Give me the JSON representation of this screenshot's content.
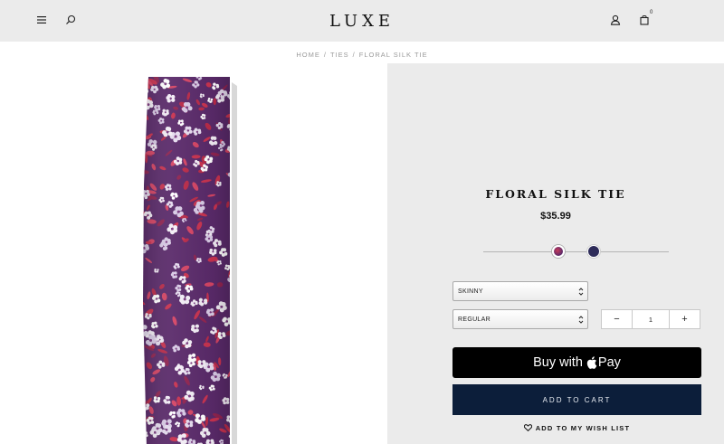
{
  "header": {
    "logo": "LUXE",
    "menu_icon": "menu-icon",
    "search_icon": "search-icon",
    "account_icon": "user-icon",
    "cart_icon": "shopping-bag-icon",
    "cart_count": "0"
  },
  "breadcrumb": {
    "items": [
      "HOME",
      "TIES",
      "FLORAL SILK TIE"
    ],
    "separator": "/"
  },
  "product": {
    "name": "FLORAL SILK TIE",
    "price": "$35.99",
    "swatches": [
      {
        "name": "floral-swatch",
        "color": "#8a2b5e",
        "selected": true
      },
      {
        "name": "navy-swatch",
        "color": "#2d2b59",
        "selected": false
      }
    ],
    "width_select": {
      "value": "SKINNY"
    },
    "length_select": {
      "value": "REGULAR"
    },
    "quantity": {
      "minus": "−",
      "value": "1",
      "plus": "+"
    },
    "apple_pay": {
      "buy_with": "Buy with",
      "pay": "Pay"
    },
    "add_to_cart": "ADD TO CART",
    "wishlist": "ADD TO MY WISH LIST"
  },
  "colors": {
    "header_bg": "#ebebeb",
    "panel_bg": "#ebebeb",
    "cart_button": "#0c1e3a",
    "apple_pay_button": "#000000",
    "tie_base": "#5a2a6a"
  }
}
